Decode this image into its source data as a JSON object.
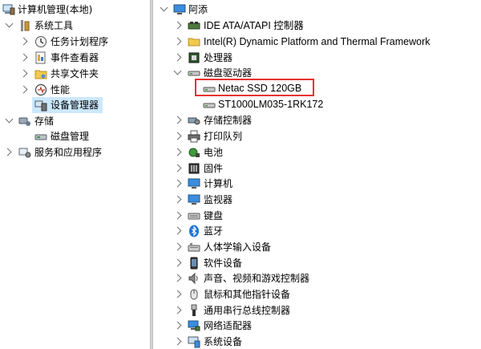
{
  "left_tree": {
    "root": {
      "label": "计算机管理(本地)",
      "icon": "computer-management-icon"
    },
    "system_tools": {
      "label": "系统工具",
      "icon": "tools-icon"
    },
    "task_scheduler": {
      "label": "任务计划程序",
      "icon": "clock-icon"
    },
    "event_viewer": {
      "label": "事件查看器",
      "icon": "event-viewer-icon"
    },
    "shared_folders": {
      "label": "共享文件夹",
      "icon": "shared-folder-icon"
    },
    "performance": {
      "label": "性能",
      "icon": "performance-icon"
    },
    "device_manager": {
      "label": "设备管理器",
      "icon": "device-manager-icon"
    },
    "storage": {
      "label": "存储",
      "icon": "storage-icon"
    },
    "disk_management": {
      "label": "磁盘管理",
      "icon": "disk-management-icon"
    },
    "services_apps": {
      "label": "服务和应用程序",
      "icon": "services-icon"
    }
  },
  "device_tree": {
    "root": {
      "label": "阿添",
      "icon": "computer-icon"
    },
    "ide": {
      "label": "IDE ATA/ATAPI 控制器",
      "icon": "ide-controller-icon"
    },
    "intel_dptf": {
      "label": "Intel(R) Dynamic Platform and Thermal Framework",
      "icon": "folder-icon"
    },
    "processor": {
      "label": "处理器",
      "icon": "processor-icon"
    },
    "disk_drives": {
      "label": "磁盘驱动器",
      "icon": "disk-drive-icon"
    },
    "netac_ssd": {
      "label": "Netac SSD 120GB",
      "icon": "drive-icon"
    },
    "st1000": {
      "label": "ST1000LM035-1RK172",
      "icon": "drive-icon"
    },
    "storage_ctrl": {
      "label": "存储控制器",
      "icon": "storage-controller-icon"
    },
    "print_queue": {
      "label": "打印队列",
      "icon": "printer-icon"
    },
    "battery": {
      "label": "电池",
      "icon": "battery-icon"
    },
    "firmware": {
      "label": "固件",
      "icon": "firmware-icon"
    },
    "computer": {
      "label": "计算机",
      "icon": "monitor-icon"
    },
    "monitors": {
      "label": "监视器",
      "icon": "monitor-icon"
    },
    "keyboards": {
      "label": "键盘",
      "icon": "keyboard-icon"
    },
    "bluetooth": {
      "label": "蓝牙",
      "icon": "bluetooth-icon"
    },
    "hid": {
      "label": "人体学输入设备",
      "icon": "hid-icon"
    },
    "software_devices": {
      "label": "软件设备",
      "icon": "software-device-icon"
    },
    "sound": {
      "label": "声音、视频和游戏控制器",
      "icon": "speaker-icon"
    },
    "mice": {
      "label": "鼠标和其他指针设备",
      "icon": "mouse-icon"
    },
    "usb": {
      "label": "通用串行总线控制器",
      "icon": "usb-icon"
    },
    "network": {
      "label": "网络适配器",
      "icon": "network-adapter-icon"
    },
    "system_devices": {
      "label": "系统设备",
      "icon": "system-device-icon"
    }
  },
  "colors": {
    "selection": "#cce8ff",
    "highlight_box": "#e8322e",
    "bluetooth": "#1e73d8",
    "monitor": "#3a8de0"
  }
}
